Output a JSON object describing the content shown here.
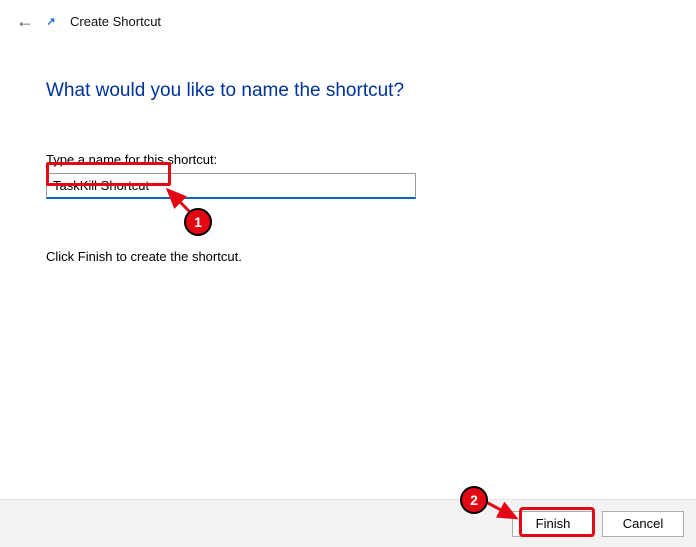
{
  "titlebar": {
    "title": "Create Shortcut"
  },
  "heading": "What would you like to name the shortcut?",
  "field_label": "Type a name for this shortcut:",
  "shortcut_name": "TaskKill Shortcut",
  "helper_text": "Click Finish to create the shortcut.",
  "buttons": {
    "finish": "Finish",
    "cancel": "Cancel"
  },
  "annotations": {
    "badge1": "1",
    "badge2": "2"
  }
}
